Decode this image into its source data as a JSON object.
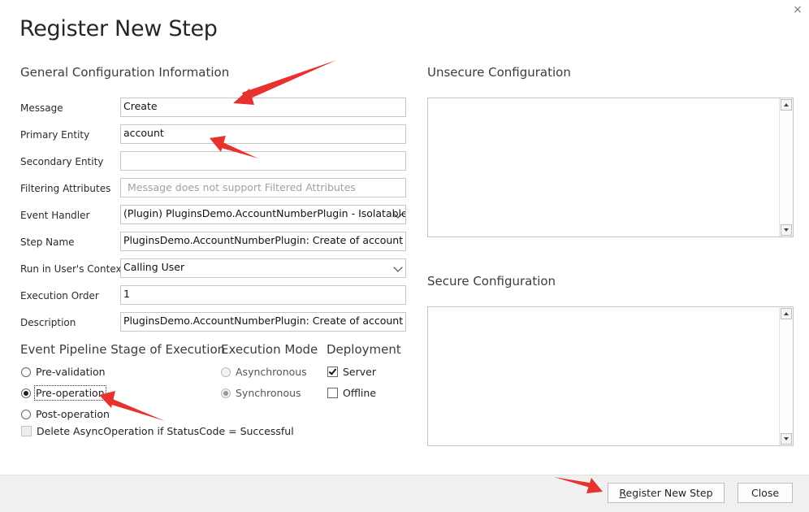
{
  "dialog": {
    "title": "Register New Step",
    "close_glyph": "×"
  },
  "general": {
    "heading": "General Configuration Information",
    "fields": {
      "message": {
        "label": "Message",
        "value": "Create"
      },
      "primary_entity": {
        "label": "Primary Entity",
        "value": "account"
      },
      "secondary_entity": {
        "label": "Secondary Entity",
        "value": ""
      },
      "filtering_attributes": {
        "label": "Filtering Attributes",
        "placeholder": "Message does not support Filtered Attributes"
      },
      "event_handler": {
        "label": "Event Handler",
        "value": "(Plugin) PluginsDemo.AccountNumberPlugin - Isolatable"
      },
      "step_name": {
        "label": "Step Name",
        "value": "PluginsDemo.AccountNumberPlugin: Create of account"
      },
      "run_context": {
        "label": "Run in User's Context",
        "value": "Calling User"
      },
      "execution_order": {
        "label": "Execution Order",
        "value": "1"
      },
      "description": {
        "label": "Description",
        "value": "PluginsDemo.AccountNumberPlugin: Create of account"
      }
    }
  },
  "pipeline": {
    "heading": "Event Pipeline Stage of Execution",
    "options": [
      {
        "label": "Pre-validation",
        "selected": false
      },
      {
        "label": "Pre-operation",
        "selected": true
      },
      {
        "label": "Post-operation",
        "selected": false
      }
    ],
    "delete_async_label": "Delete AsyncOperation if StatusCode = Successful"
  },
  "execution_mode": {
    "heading": "Execution Mode",
    "options": [
      {
        "label": "Asynchronous",
        "selected": false
      },
      {
        "label": "Synchronous",
        "selected": true
      }
    ]
  },
  "deployment": {
    "heading": "Deployment",
    "options": [
      {
        "label": "Server",
        "checked": true
      },
      {
        "label": "Offline",
        "checked": false
      }
    ]
  },
  "unsecure": {
    "heading": "Unsecure  Configuration"
  },
  "secure": {
    "heading": "Secure  Configuration"
  },
  "footer": {
    "register_label_accel": "R",
    "register_label_rest": "egister New Step",
    "close_label": "Close"
  },
  "colors": {
    "annotation_arrow": "#e8322f",
    "footer_bg": "#f0f0f0",
    "border": "#c6c6c6"
  }
}
